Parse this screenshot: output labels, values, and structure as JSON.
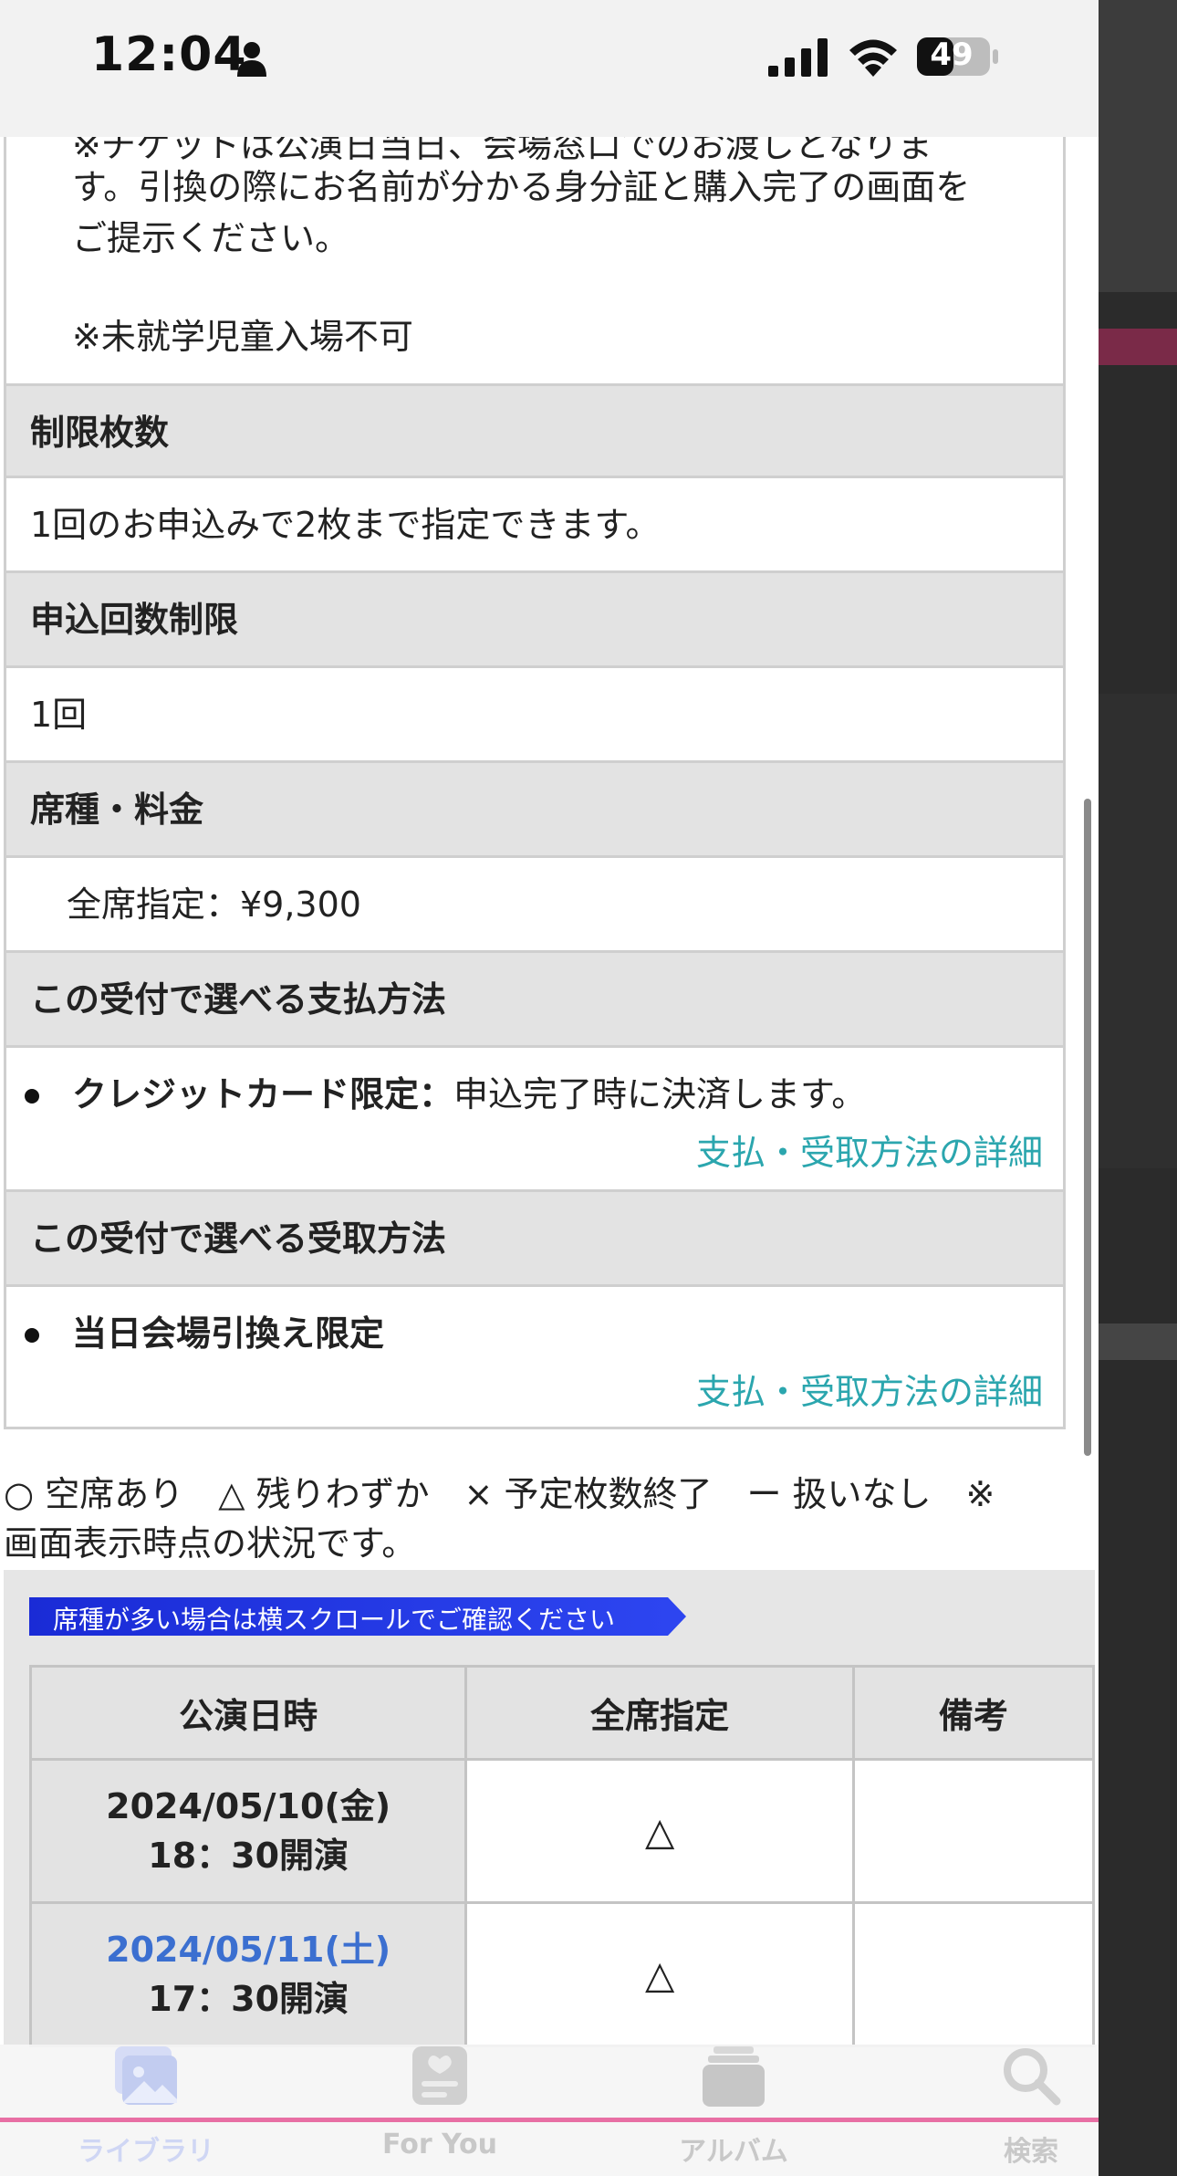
{
  "status_bar": {
    "time": "12:04",
    "battery": "49"
  },
  "notes": {
    "line_cut": "※チケットは公演日当日、会場窓口でのお渡しとなりま",
    "line_1": "す。引換の際にお名前が分かる身分証と購入完了の画面を",
    "line_2": "ご提示ください。",
    "line_3": "※未就学児童入場不可"
  },
  "sections": {
    "limit_heading": "制限枚数",
    "limit_value": "1回のお申込みで2枚まで指定できます。",
    "apply_limit_heading": "申込回数制限",
    "apply_limit_value": "1回",
    "seat_heading": "席種・料金",
    "seat_value": "全席指定：¥9,300",
    "payment_heading": "この受付で選べる支払方法",
    "payment_bold": "クレジットカード限定：",
    "payment_text": "申込完了時に決済します。",
    "payment_link": "支払・受取方法の詳細",
    "receive_heading": "この受付で選べる受取方法",
    "receive_bold": "当日会場引換え限定",
    "receive_link": "支払・受取方法の詳細"
  },
  "legend": {
    "line_1": "○ 空席あり　△ 残りわずか　× 予定枚数終了　ー 扱いなし　※",
    "line_2": "画面表示時点の状況です。"
  },
  "schedule": {
    "banner": "席種が多い場合は横スクロールでご確認ください",
    "headers": [
      "公演日時",
      "全席指定",
      "備考"
    ],
    "rows": [
      {
        "date": "2024/05/10(金)",
        "time": "18：30開演",
        "seat": "△",
        "note": ""
      },
      {
        "date": "2024/05/11(土)",
        "time": "17：30開演",
        "seat": "△",
        "note": ""
      }
    ]
  },
  "tabbar": {
    "tabs": [
      {
        "label": "ライブラリ",
        "icon": "photo-library-icon",
        "active": true
      },
      {
        "label": "For You",
        "icon": "for-you-icon",
        "active": false
      },
      {
        "label": "アルバム",
        "icon": "album-icon",
        "active": false
      },
      {
        "label": "検索",
        "icon": "search-icon",
        "active": false
      }
    ]
  },
  "colors": {
    "header_bg": "#e3e3e3",
    "link": "#2ba6ae",
    "banner": "#2d45f0",
    "highlight_date": "#3b6fd0",
    "tab_accent": "#e86fa4"
  }
}
